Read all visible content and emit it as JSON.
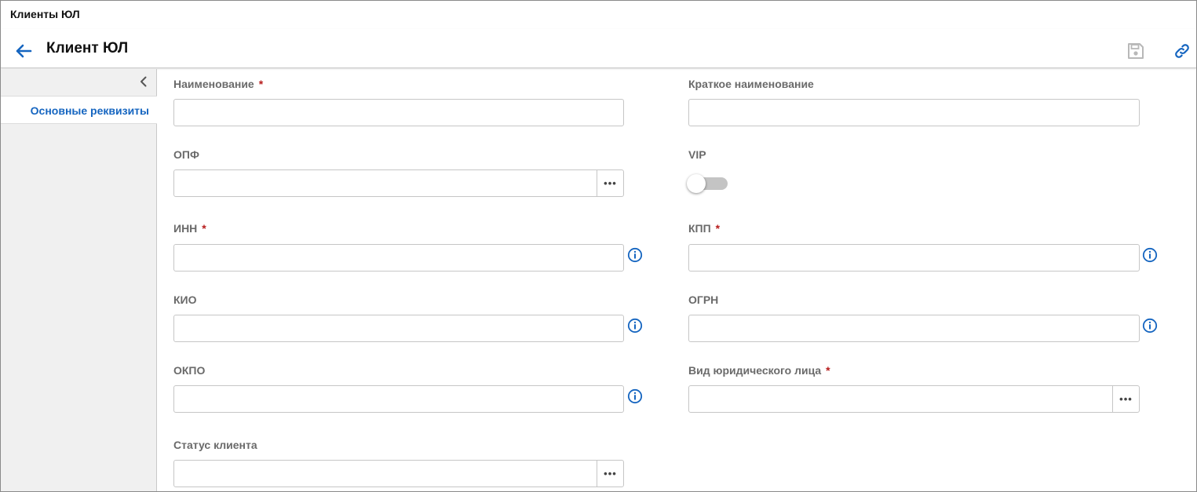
{
  "window": {
    "title": "Клиенты ЮЛ"
  },
  "header": {
    "title": "Клиент ЮЛ"
  },
  "sidebar": {
    "items": [
      {
        "label": "Основные реквизиты",
        "active": true
      }
    ]
  },
  "form": {
    "name": {
      "label": "Наименование",
      "required": "*",
      "value": ""
    },
    "short_name": {
      "label": "Краткое наименование",
      "value": ""
    },
    "opf": {
      "label": "ОПФ",
      "value": "",
      "button": "•••"
    },
    "vip": {
      "label": "VIP",
      "checked": false
    },
    "inn": {
      "label": "ИНН",
      "required": "*",
      "value": ""
    },
    "kpp": {
      "label": "КПП",
      "required": "*",
      "value": ""
    },
    "kio": {
      "label": "КИО",
      "value": ""
    },
    "ogrn": {
      "label": "ОГРН",
      "value": ""
    },
    "okpo": {
      "label": "ОКПО",
      "value": ""
    },
    "legal_type": {
      "label": "Вид юридического лица",
      "required": "*",
      "value": "",
      "button": "•••"
    },
    "client_status": {
      "label": "Статус клиента",
      "value": "",
      "button": "•••"
    }
  },
  "colors": {
    "accent": "#1565c0",
    "required": "#b71c1c",
    "label": "#6a6a6a",
    "sidebar_bg": "#f0f0f0"
  },
  "icons": {
    "back": "arrow-left-icon",
    "save": "floppy-disk-icon",
    "link": "link-icon",
    "collapse": "chevron-left-icon",
    "info": "info-circle-icon"
  }
}
